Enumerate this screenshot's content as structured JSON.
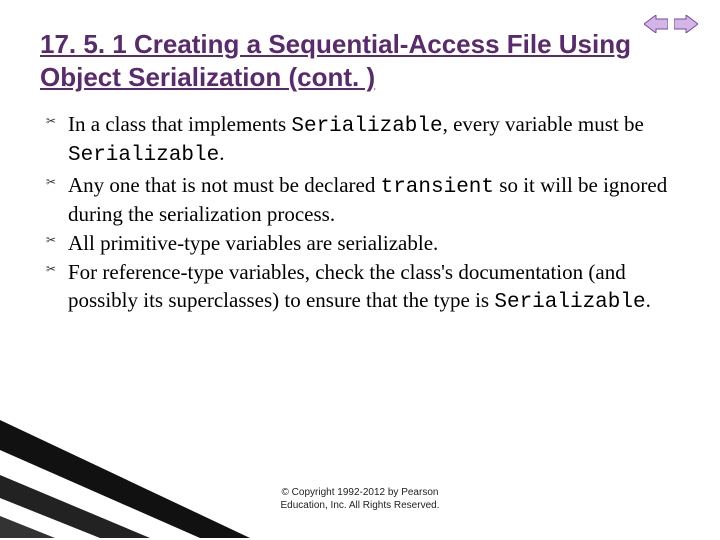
{
  "nav": {
    "prev_icon": "prev-arrow",
    "next_icon": "next-arrow"
  },
  "title": "17. 5. 1 Creating a Sequential-Access File Using Object Serialization (cont. )",
  "bullets": [
    {
      "pre": "In a class that implements ",
      "code1": "Serializable",
      "mid": ", every variable must be ",
      "code2": "Serializable",
      "post": "."
    },
    {
      "pre": "Any one that is not must be declared ",
      "code1": "transient",
      "mid": " so it will be ignored during the serialization process.",
      "code2": "",
      "post": ""
    },
    {
      "pre": "All primitive-type variables are serializable.",
      "code1": "",
      "mid": "",
      "code2": "",
      "post": ""
    },
    {
      "pre": "For reference-type variables, check the class's documentation (and possibly its superclasses) to ensure that the type is ",
      "code1": "Serializable",
      "mid": ".",
      "code2": "",
      "post": ""
    }
  ],
  "copyright_line1": "© Copyright 1992-2012 by Pearson",
  "copyright_line2": "Education, Inc. All Rights Reserved."
}
